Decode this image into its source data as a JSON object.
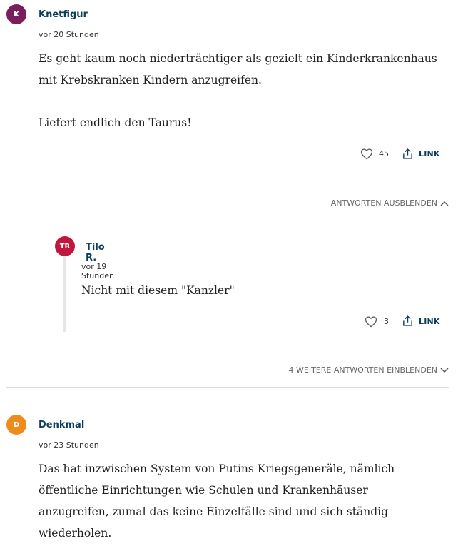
{
  "comments": [
    {
      "initials": "K",
      "avatar_color": "#7a1f5e",
      "author": "Knetfigur",
      "time": "vor 20 Stunden",
      "text": "Es geht kaum noch niederträchtiger als gezielt ein Kinderkrankenhaus\nmit Krebskranken Kindern anzugreifen.\n\nLiefert endlich den Taurus!",
      "likes": "45",
      "link_label": "LINK",
      "hide_replies_label": "ANTWORTEN AUSBLENDEN",
      "reply": {
        "initials": "TR",
        "avatar_color": "#c0173f",
        "author": "Tilo R.",
        "time": "vor 19 Stunden",
        "text": "Nicht mit diesem \"Kanzler\"",
        "likes": "3",
        "link_label": "LINK"
      },
      "more_replies_label": "4 WEITERE ANTWORTEN EINBLENDEN"
    },
    {
      "initials": "D",
      "avatar_color": "#ef8a1d",
      "author": "Denkmal",
      "time": "vor 23 Stunden",
      "text": "Das hat inzwischen System von Putins Kriegsgeneräle, nämlich\nöffentliche Einrichtungen wie Schulen und Krankenhäuser\nanzugreifen, zumal das keine Einzelfälle sind und sich ständig\nwiederholen."
    }
  ],
  "icons": {
    "like": "heart-outline-icon",
    "share": "share-upload-icon",
    "chevron_up": "chevron-up-icon",
    "chevron_down": "chevron-down-icon"
  }
}
